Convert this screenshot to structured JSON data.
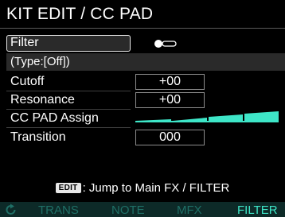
{
  "header": {
    "title": "KIT EDIT / CC PAD"
  },
  "filter": {
    "label": "Filter",
    "switch_icon": "toggle-switch-icon",
    "switch_state": "off",
    "type_text": "(Type:[Off])"
  },
  "params": [
    {
      "label": "Cutoff",
      "value": "+00"
    },
    {
      "label": "Resonance",
      "value": "+00"
    },
    {
      "label": "CC PAD Assign",
      "value": ""
    },
    {
      "label": "Transition",
      "value": "000"
    }
  ],
  "hint": {
    "badge": "EDIT",
    "text": ": Jump to Main FX / FILTER"
  },
  "tabs": [
    {
      "label": "TRANS",
      "active": false
    },
    {
      "label": "NOTE",
      "active": false
    },
    {
      "label": "MFX",
      "active": false
    },
    {
      "label": "FILTER",
      "active": true
    }
  ],
  "colors": {
    "accent": "#3ee6c8",
    "tab_inactive": "#1f6f66",
    "tabbar_bg": "#0d2a28",
    "selected_bg": "#2a2a2a"
  }
}
